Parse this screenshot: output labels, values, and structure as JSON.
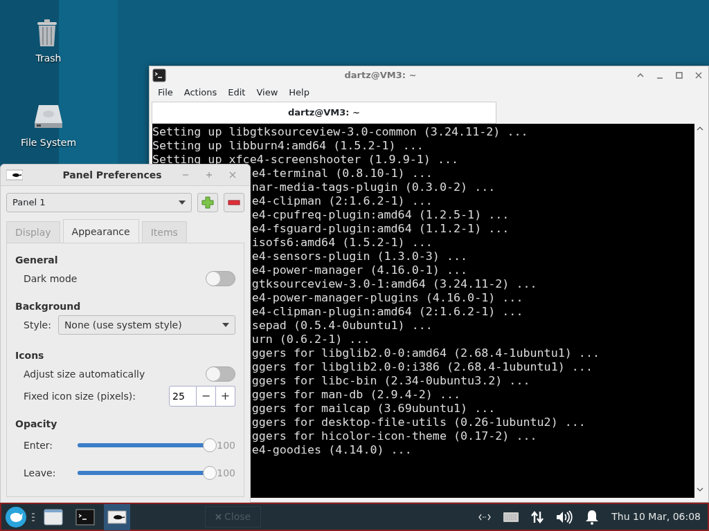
{
  "desktop_icons": [
    {
      "label": "Trash",
      "kind": "trash"
    },
    {
      "label": "File System",
      "kind": "drive"
    }
  ],
  "terminal": {
    "title": "dartz@VM3: ~",
    "menu": [
      "File",
      "Actions",
      "Edit",
      "View",
      "Help"
    ],
    "tabs": [
      {
        "label": "dartz@VM3: ~",
        "selected": true
      }
    ],
    "lines": [
      {
        "kind": "full",
        "text": "Setting up libgtksourceview-3.0-common (3.24.11-2) ..."
      },
      {
        "kind": "full",
        "text": "Setting up libburn4:amd64 (1.5.2-1) ..."
      },
      {
        "kind": "full",
        "text": "Setting up xfce4-screenshooter (1.9.9-1) ..."
      },
      {
        "kind": "partial",
        "text": "e4-terminal (0.8.10-1) ..."
      },
      {
        "kind": "partial",
        "text": "nar-media-tags-plugin (0.3.0-2) ..."
      },
      {
        "kind": "partial",
        "text": "e4-clipman (2:1.6.2-1) ..."
      },
      {
        "kind": "partial",
        "text": "e4-cpufreq-plugin:amd64 (1.2.5-1) ..."
      },
      {
        "kind": "partial",
        "text": "e4-fsguard-plugin:amd64 (1.1.2-1) ..."
      },
      {
        "kind": "partial",
        "text": "isofs6:amd64 (1.5.2-1) ..."
      },
      {
        "kind": "partial",
        "text": "e4-sensors-plugin (1.3.0-3) ..."
      },
      {
        "kind": "partial",
        "text": "e4-power-manager (4.16.0-1) ..."
      },
      {
        "kind": "partial",
        "text": "gtksourceview-3.0-1:amd64 (3.24.11-2) ..."
      },
      {
        "kind": "partial",
        "text": "e4-power-manager-plugins (4.16.0-1) ..."
      },
      {
        "kind": "partial",
        "text": "e4-clipman-plugin:amd64 (2:1.6.2-1) ..."
      },
      {
        "kind": "partial",
        "text": "sepad (0.5.4-0ubuntu1) ..."
      },
      {
        "kind": "partial",
        "text": "urn (0.6.2-1) ..."
      },
      {
        "kind": "partial",
        "text": "ggers for libglib2.0-0:amd64 (2.68.4-1ubuntu1) ..."
      },
      {
        "kind": "partial",
        "text": "ggers for libglib2.0-0:i386 (2.68.4-1ubuntu1) ..."
      },
      {
        "kind": "partial",
        "text": "ggers for libc-bin (2.34-0ubuntu3.2) ..."
      },
      {
        "kind": "partial",
        "text": "ggers for man-db (2.9.4-2) ..."
      },
      {
        "kind": "partial",
        "text": "ggers for mailcap (3.69ubuntu1) ..."
      },
      {
        "kind": "partial",
        "text": "ggers for desktop-file-utils (0.26-1ubuntu2) ..."
      },
      {
        "kind": "partial",
        "text": "ggers for hicolor-icon-theme (0.17-2) ..."
      },
      {
        "kind": "partial",
        "text": "e4-goodies (4.14.0) ..."
      }
    ]
  },
  "preferences": {
    "title": "Panel Preferences",
    "panel": "Panel 1",
    "tabs": [
      {
        "label": "Display",
        "selected": false
      },
      {
        "label": "Appearance",
        "selected": true
      },
      {
        "label": "Items",
        "selected": false
      }
    ],
    "sections": [
      {
        "heading": "General",
        "rows": [
          {
            "kind": "toggle",
            "label": "Dark mode",
            "on": false
          }
        ]
      },
      {
        "heading": "Background",
        "rows": [
          {
            "kind": "select",
            "label": "Style:",
            "value": "None (use system style)"
          }
        ]
      },
      {
        "heading": "Icons",
        "rows": [
          {
            "kind": "toggle",
            "label": "Adjust size automatically",
            "on": false
          },
          {
            "kind": "spin",
            "label": "Fixed icon size (pixels):",
            "value": "25",
            "decrement": "−",
            "increment": "+"
          }
        ]
      },
      {
        "heading": "Opacity",
        "rows": [
          {
            "kind": "slider",
            "label": "Enter:",
            "level": 1,
            "reading": "100"
          },
          {
            "kind": "slider",
            "label": "Leave:",
            "level": 1,
            "reading": "100"
          }
        ]
      }
    ],
    "close_button": "Close"
  },
  "taskbar": {
    "items": [
      {
        "kind": "desktop",
        "active": false
      },
      {
        "kind": "terminal",
        "active": false
      },
      {
        "kind": "preferences",
        "active": true
      }
    ],
    "clock": "Thu 10 Mar, 06:08"
  }
}
